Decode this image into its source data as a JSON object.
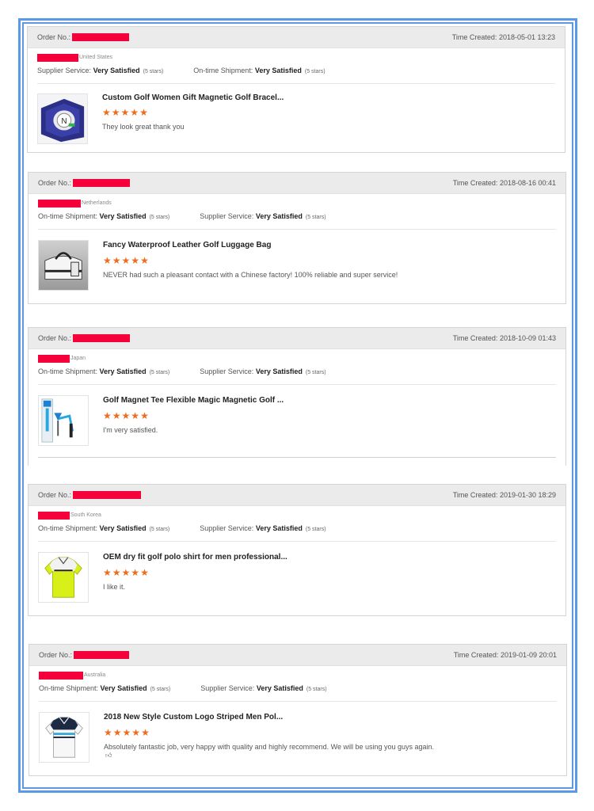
{
  "order_label": "Order No.:",
  "time_label": "Time Created:",
  "rating_value": "Very Satisfied",
  "stars_note": "(5 stars)",
  "colors": {
    "accent_frame": "#5a9ae0",
    "redaction": "#f5003a",
    "star": "#ef6c1e"
  },
  "reviews": [
    {
      "time": "2018-05-01 13:23",
      "country": "United States",
      "rating1_label": "Supplier Service:",
      "rating2_label": "On-time Shipment:",
      "title": "Custom Golf Women Gift Magnetic Golf Bracel...",
      "comment": "They look great thank you",
      "stars": 5,
      "image": "golf-bracelet-gift-box"
    },
    {
      "time": "2018-08-16 00:41",
      "country": "Netherlands",
      "rating1_label": "On-time Shipment:",
      "rating2_label": "Supplier Service:",
      "title": "Fancy Waterproof Leather Golf Luggage Bag",
      "comment": "NEVER had such a pleasant contact with a Chinese factory! 100% reliable and super service!",
      "stars": 5,
      "image": "golf-luggage-bag"
    },
    {
      "time": "2018-10-09 01:43",
      "country": "Japan",
      "rating1_label": "On-time Shipment:",
      "rating2_label": "Supplier Service:",
      "title": "Golf Magnet Tee Flexible Magic Magnetic Golf ...",
      "comment": "I'm very satisfied.",
      "stars": 5,
      "image": "golf-magnet-tee"
    },
    {
      "time": "2019-01-30 18:29",
      "country": "South Korea",
      "rating1_label": "On-time Shipment:",
      "rating2_label": "Supplier Service:",
      "title": "OEM dry fit golf polo shirt for men professional...",
      "comment": "I like it.",
      "stars": 5,
      "image": "yellow-polo-shirt"
    },
    {
      "time": "2019-01-09 20:01",
      "country": "Australia",
      "rating1_label": "On-time Shipment:",
      "rating2_label": "Supplier Service:",
      "title": "2018 New Style Custom Logo Striped Men Pol...",
      "comment": "Absolutely fantastic job, very happy with quality and highly recommend. We will be using you guys again.",
      "stars": 5,
      "image": "striped-polo-shirt",
      "extra_icon": "thumbs-up-icon"
    }
  ]
}
